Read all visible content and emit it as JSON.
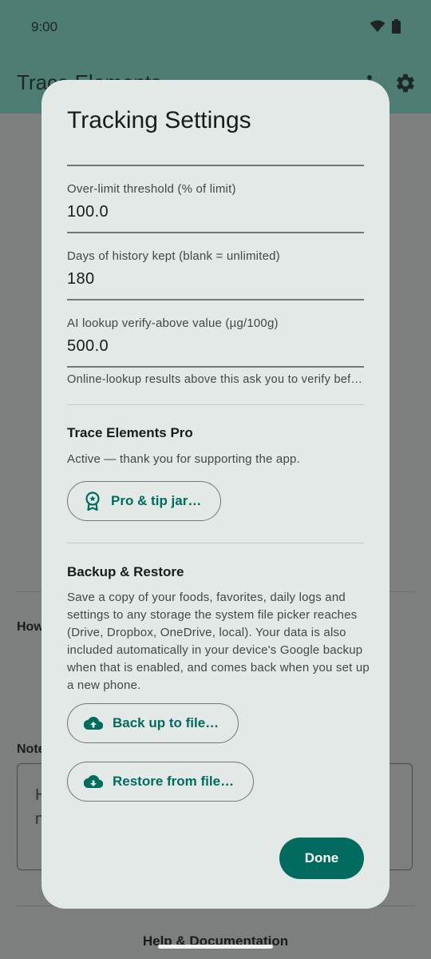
{
  "status_bar": {
    "time": "9:00"
  },
  "app_bar": {
    "title": "Trace Elements"
  },
  "background": {
    "how_label": "How",
    "notes_label": "Notes",
    "notes_preview": [
      "H",
      "n"
    ],
    "help_label": "Help & Documentation"
  },
  "dialog": {
    "title": "Tracking Settings",
    "fields": [
      {
        "label": "Over-limit threshold (% of limit)",
        "value": "100.0"
      },
      {
        "label": "Days of history kept (blank = unlimited)",
        "value": "180"
      },
      {
        "label": "AI lookup verify-above value (µg/100g)",
        "value": "500.0",
        "help": "Online-lookup results above this ask you to verify before saving"
      }
    ],
    "pro": {
      "title": "Trace Elements Pro",
      "text": "Active — thank you for supporting the app.",
      "button_label": "Pro & tip jar…",
      "button_icon": "award-badge-icon"
    },
    "backup": {
      "title": "Backup & Restore",
      "text": "Save a copy of your foods, favorites, daily logs and settings to any storage the system file picker reaches (Drive, Dropbox, OneDrive, local). Your data is also included automatically in your device's Google backup when that is enabled, and comes back when you set up a new phone.",
      "backup_label": "Back up to file…",
      "backup_icon": "cloud-upload-icon",
      "restore_label": "Restore from file…",
      "restore_icon": "cloud-download-icon"
    },
    "done_label": "Done"
  },
  "colors": {
    "accent": "#006b5e",
    "dialog_bg": "#e3e9e7",
    "scrim": "#7d7f7e",
    "app_bar": "#4e7d73"
  }
}
